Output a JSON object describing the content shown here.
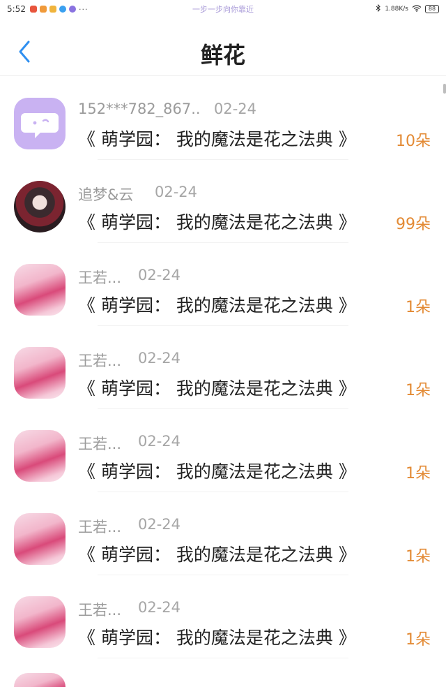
{
  "status_bar": {
    "time": "5:52",
    "more": "···",
    "center_text": "一步一步向你靠近",
    "network_speed": "1.88K/s",
    "battery": "88",
    "app_colors": [
      "#e8553d",
      "#f09a3a",
      "#f0b43c",
      "#3aa0f0",
      "#8a73e0"
    ]
  },
  "header": {
    "title": "鲜花",
    "back_icon": "chevron-left-icon",
    "back_color": "#2f8ff0"
  },
  "rows": [
    {
      "user": "152***782_867..",
      "date": "02-24",
      "book": "《 萌学园： 我的魔法是花之法典 》",
      "amount": "10朵",
      "avatar": "app"
    },
    {
      "user": "追梦&云",
      "date": "02-24",
      "book": "《 萌学园： 我的魔法是花之法典 》",
      "amount": "99朵",
      "avatar": "round"
    },
    {
      "user": "王若...",
      "date": "02-24",
      "book": "《 萌学园： 我的魔法是花之法典 》",
      "amount": "1朵",
      "avatar": "anime"
    },
    {
      "user": "王若...",
      "date": "02-24",
      "book": "《 萌学园： 我的魔法是花之法典 》",
      "amount": "1朵",
      "avatar": "anime"
    },
    {
      "user": "王若...",
      "date": "02-24",
      "book": "《 萌学园： 我的魔法是花之法典 》",
      "amount": "1朵",
      "avatar": "anime"
    },
    {
      "user": "王若...",
      "date": "02-24",
      "book": "《 萌学园： 我的魔法是花之法典 》",
      "amount": "1朵",
      "avatar": "anime"
    },
    {
      "user": "王若...",
      "date": "02-24",
      "book": "《 萌学园： 我的魔法是花之法典 》",
      "amount": "1朵",
      "avatar": "anime"
    }
  ],
  "colors": {
    "amount": "#e38a34",
    "app_avatar": "#c9b2f2"
  }
}
